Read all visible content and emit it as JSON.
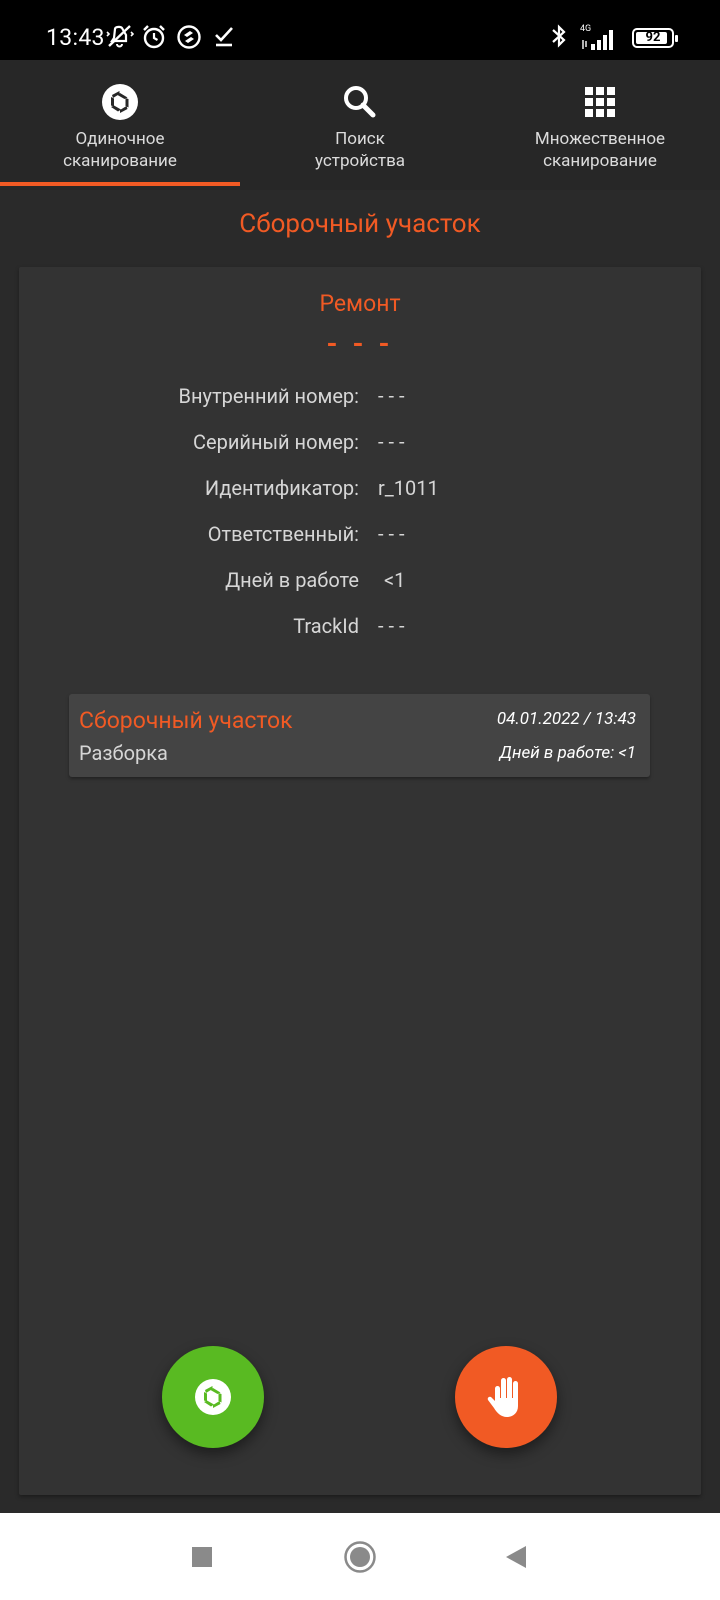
{
  "status_bar": {
    "time": "13:43",
    "icons": [
      "mute-vibrate-icon",
      "alarm-icon",
      "sync-icon",
      "check-icon"
    ],
    "network": "4G",
    "battery": "92",
    "battery_level": 0.92
  },
  "tabs": [
    {
      "label": "Одиночное\nсканирование",
      "icon": "aperture-icon",
      "active": true
    },
    {
      "label": "Поиск\nустройства",
      "icon": "search-icon",
      "active": false
    },
    {
      "label": "Множественное\nсканирование",
      "icon": "grid-icon",
      "active": false
    }
  ],
  "main": {
    "section_title": "Сборочный участок",
    "card": {
      "title": "Ремонт",
      "subtitle": "- - -",
      "fields": [
        {
          "label": "Внутренний номер:",
          "value": "- - -"
        },
        {
          "label": "Серийный номер:",
          "value": "- - -"
        },
        {
          "label": "Идентификатор:",
          "value": "r_1011"
        },
        {
          "label": "Ответственный:",
          "value": "- - -"
        },
        {
          "label": "Дней в работе",
          "value": "<1"
        },
        {
          "label": "TrackId",
          "value": "- - -"
        }
      ],
      "history": [
        {
          "place": "Сборочный участок",
          "step": "Разборка",
          "date": "04.01.2022 / 13:43",
          "days": "Дней в работе:  <1"
        }
      ]
    },
    "buttons": {
      "scan_icon": "aperture-icon",
      "stop_icon": "hand-stop-icon"
    }
  },
  "colors": {
    "accent": "#f15a24",
    "scan_green": "#59ba22",
    "background": "#2a2a2a",
    "card": "#333333"
  },
  "nav_bar": {
    "icons": [
      "recents-square-icon",
      "home-circle-icon",
      "back-triangle-icon"
    ]
  }
}
